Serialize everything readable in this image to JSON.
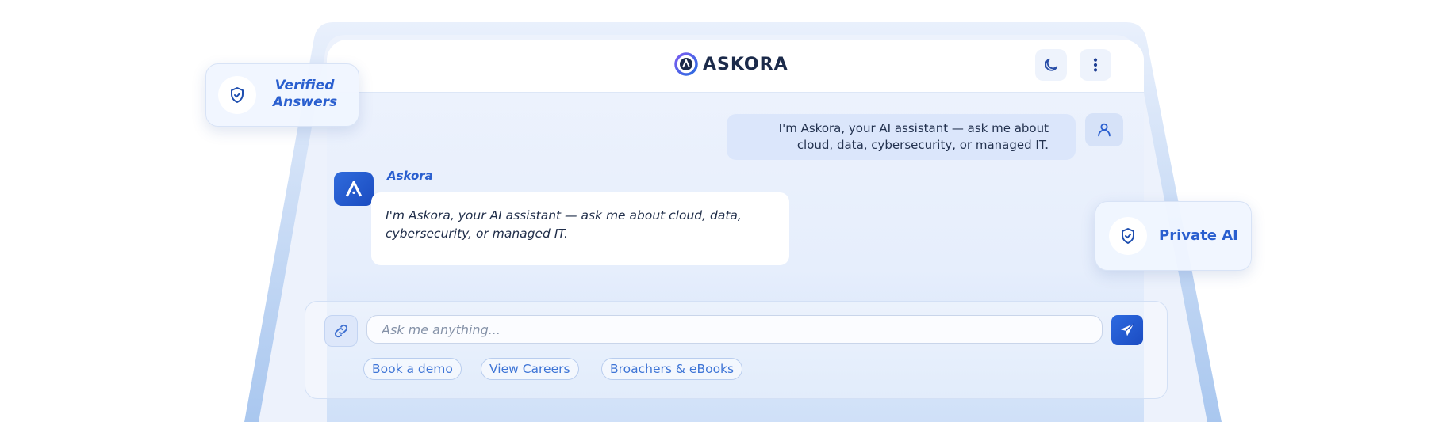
{
  "app": {
    "brand_name": "ASKORA",
    "accent_color": "#2a5fcf"
  },
  "header": {
    "icons": [
      "moon-icon",
      "more-vertical-icon"
    ]
  },
  "messages": {
    "user_text": "I'm Askora, your AI assistant — ask me about cloud, data, cybersecurity, or managed IT.",
    "bot_name": "Askora",
    "bot_text": "I'm Askora, your AI assistant — ask me about cloud, data, cybersecurity, or managed IT."
  },
  "composer": {
    "placeholder": "Ask me anything...",
    "value": ""
  },
  "chips": [
    {
      "label": "Book a demo"
    },
    {
      "label": "View Careers"
    },
    {
      "label": "Broachers & eBooks"
    }
  ],
  "badges": {
    "verified_line1": "Verified",
    "verified_line2": "Answers",
    "private": "Private AI"
  }
}
